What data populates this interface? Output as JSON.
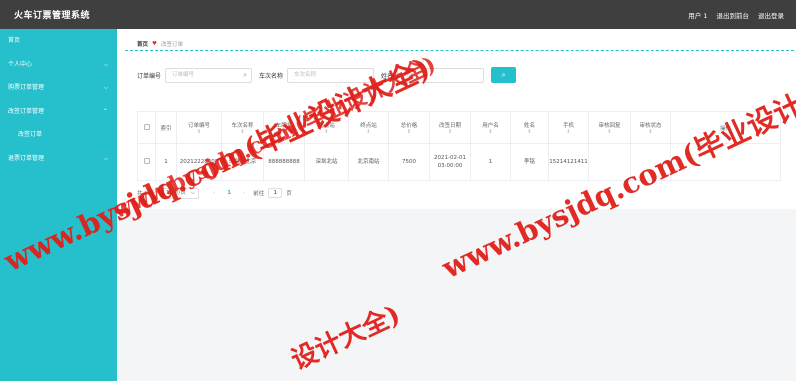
{
  "header": {
    "title": "火车订票管理系统",
    "user": "用户 1",
    "back_to_admin": "退出到前台",
    "logout": "退出登录"
  },
  "sidebar": {
    "items": [
      {
        "label": "首页"
      },
      {
        "label": "个人中心"
      },
      {
        "label": "购票订单管理"
      },
      {
        "label": "改签订单管理"
      },
      {
        "label": "改签订单"
      },
      {
        "label": "退票订单管理"
      }
    ]
  },
  "breadcrumb": {
    "home": "首页",
    "current": "改签订单"
  },
  "search": {
    "order_label": "订单编号",
    "order_placeholder": "订单编号",
    "train_label": "车次名称",
    "train_placeholder": "车次名称",
    "name_label": "姓名",
    "name_placeholder": "姓名",
    "search_icon": "search-icon"
  },
  "table": {
    "columns": [
      "索引",
      "订单编号",
      "车次名称",
      "车牌号",
      "起点站",
      "终点站",
      "总价格",
      "改签日期",
      "用户名",
      "姓名",
      "手机",
      "审核回复",
      "审核状态",
      "操作"
    ],
    "rows": [
      {
        "index": "1",
        "order_no": "20212228408",
        "train_name": "深圳到北京",
        "plate": "888888888",
        "start": "深圳北站",
        "end": "北京南站",
        "price": "7500",
        "date": "2021-02-01 03:00:00",
        "username": "1",
        "name": "李铭",
        "phone": "15214121411",
        "reply": "",
        "status": ""
      }
    ]
  },
  "pager": {
    "total": "共 1 条",
    "page_size": "10条/页",
    "current_page": "1",
    "goto_label": "前往",
    "goto_value": "1",
    "page_suffix": "页"
  },
  "watermarks": {
    "top_left": "www.bysjdq.com(毕业设计大全)",
    "top_right": "www.bysjdq.com(毕业设计大全)",
    "center": "www.bysjdq.com(毕业设计大全)",
    "bottom": "设计大全)"
  },
  "colors": {
    "accent": "#26c0cd",
    "header": "#3f3f3f",
    "watermark": "#e0201a"
  }
}
